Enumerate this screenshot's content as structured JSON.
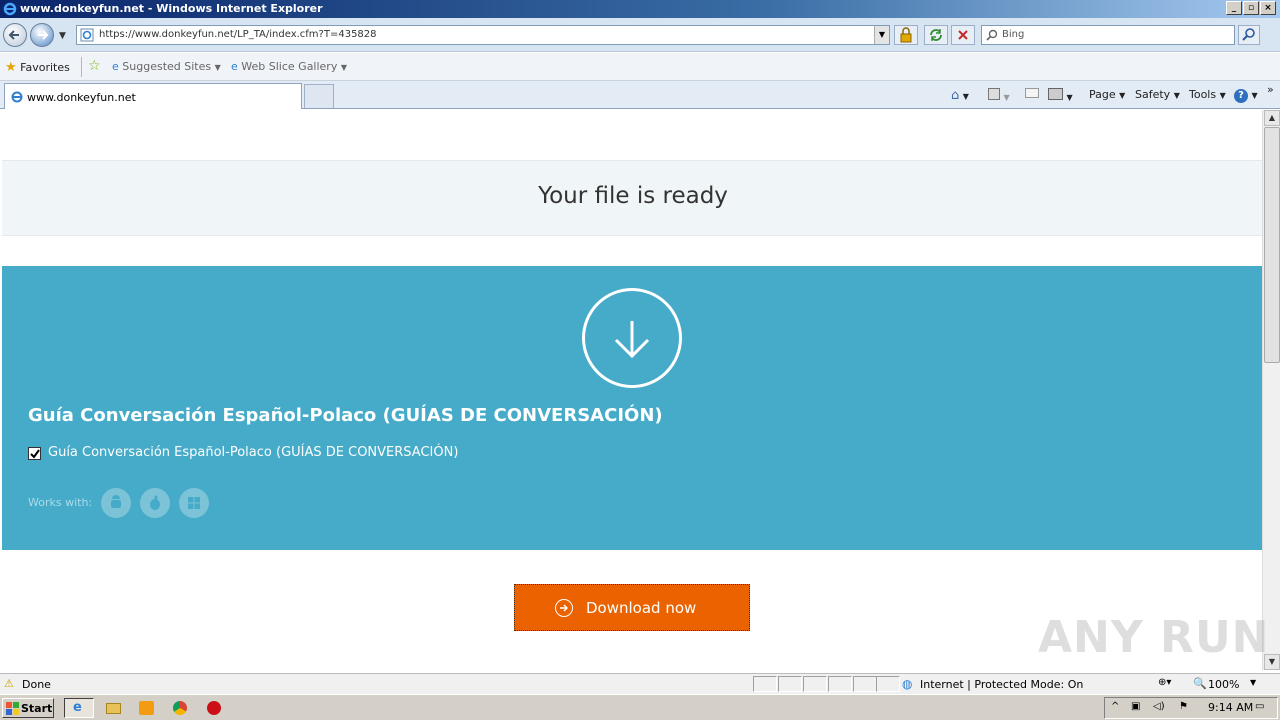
{
  "window": {
    "title": "www.donkeyfun.net - Windows Internet Explorer"
  },
  "address_bar": {
    "url": "https://www.donkeyfun.net/LP_TA/index.cfm?T=435828",
    "search_placeholder": "Bing"
  },
  "favorites_bar": {
    "favorites_label": "Favorites",
    "suggested_sites_label": "Suggested Sites",
    "web_slice_label": "Web Slice Gallery"
  },
  "tab": {
    "label": "www.donkeyfun.net"
  },
  "command_bar": {
    "page_label": "Page",
    "safety_label": "Safety",
    "tools_label": "Tools"
  },
  "page": {
    "heading": "Your file is ready",
    "product_title": "Guía Conversación Español-Polaco (GUÍAS DE CONVERSACIÓN)",
    "checkbox_label": "Guía Conversación Español-Polaco (GUÍAS DE CONVERSACIÓN)",
    "works_with_label": "Works with:",
    "os_icons": [
      "android-icon",
      "apple-icon",
      "windows-icon"
    ],
    "download_button_label": "Download now",
    "accent_color": "#45abc9",
    "button_color": "#ea6300"
  },
  "watermark": "ANY RUN",
  "status_bar": {
    "status_text": "Done",
    "zone_text": "Internet | Protected Mode: On",
    "zoom": "100%"
  },
  "taskbar": {
    "start_label": "Start",
    "clock": "9:14 AM"
  }
}
